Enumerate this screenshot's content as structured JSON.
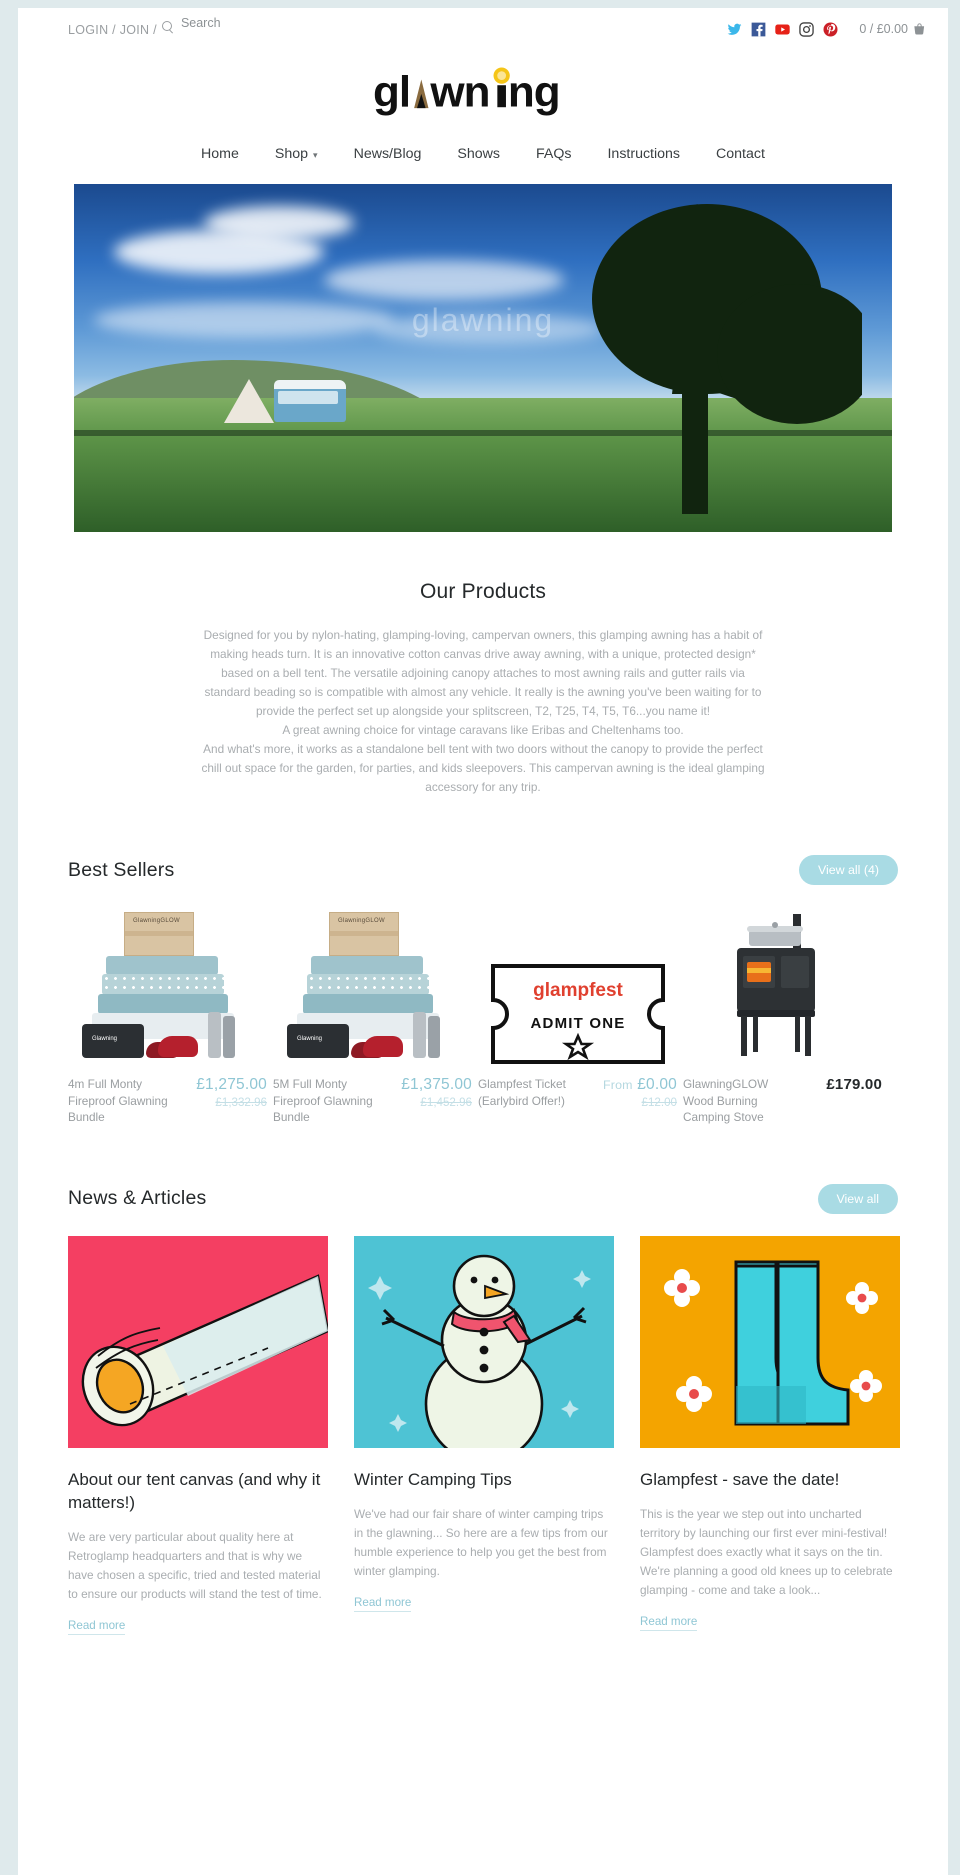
{
  "topbar": {
    "account_label": "LOGIN / JOIN /",
    "search_placeholder": "Search",
    "search_value": "",
    "social": [
      {
        "name": "twitter",
        "color": "#3bb7ea"
      },
      {
        "name": "facebook",
        "color": "#3b5998"
      },
      {
        "name": "youtube",
        "color": "#e62117"
      },
      {
        "name": "instagram",
        "color": "#3f3f3f"
      },
      {
        "name": "pinterest",
        "color": "#cb2027"
      }
    ],
    "cart_label": "0 / £0.00"
  },
  "brand": {
    "name": "glawning",
    "logo_text_color": "#111111",
    "logo_accent_color": "#8a6b3f",
    "logo_sun_color": "#f5c518"
  },
  "nav": {
    "items": [
      {
        "label": "Home",
        "has_dropdown": false
      },
      {
        "label": "Shop",
        "has_dropdown": true
      },
      {
        "label": "News/Blog",
        "has_dropdown": false
      },
      {
        "label": "Shows",
        "has_dropdown": false
      },
      {
        "label": "FAQs",
        "has_dropdown": false
      },
      {
        "label": "Instructions",
        "has_dropdown": false
      },
      {
        "label": "Contact",
        "has_dropdown": false
      }
    ]
  },
  "hero": {
    "watermark": "glawning",
    "alt": "campervan with glawning awning and bell tent in a field at dusk"
  },
  "products_section": {
    "title": "Our Products",
    "paragraphs": [
      "Designed for you by nylon-hating, glamping-loving, campervan owners, this glamping awning has a habit of making heads turn. It is an innovative cotton canvas drive away awning, with a unique, protected design* based on a bell tent. The versatile adjoining canopy attaches to most awning rails and gutter rails via standard beading so is compatible with almost any vehicle. It really is the awning you've been waiting for to provide the perfect set up alongside your splitscreen, T2, T25, T4, T5, T6...you name it!",
      "A great awning choice for vintage caravans like Eribas and Cheltenhams too.",
      "And what's more, it works as a standalone bell tent with two doors without the canopy to provide the perfect chill out space for the garden, for parties, and kids sleepovers. This campervan awning is the ideal glamping accessory for any trip."
    ]
  },
  "best_sellers": {
    "title": "Best Sellers",
    "view_all_label": "View all (4)",
    "items": [
      {
        "name": "4m Full Monty Fireproof Glawning Bundle",
        "price": "£1,275.00",
        "price_prefix": "",
        "price_old": "£1,332.96",
        "image": "bundle-image",
        "box_label": "GlawningGLOW",
        "bag_label": "Glawning"
      },
      {
        "name": "5M Full Monty Fireproof Glawning Bundle",
        "price": "£1,375.00",
        "price_prefix": "",
        "price_old": "£1,452.96",
        "image": "bundle-image",
        "box_label": "GlawningGLOW",
        "bag_label": "Glawning"
      },
      {
        "name": "Glampfest Ticket (Earlybird Offer!)",
        "price": "£0.00",
        "price_prefix": "From",
        "price_old": "£12.00",
        "image": "ticket-image",
        "ticket_word": "glampfest",
        "ticket_admit": "ADMIT ONE"
      },
      {
        "name": "GlawningGLOW Wood Burning Camping Stove",
        "price": "£179.00",
        "price_prefix": "",
        "price_old": "",
        "image": "stove-image",
        "price_style": "dark"
      }
    ]
  },
  "news": {
    "title": "News & Articles",
    "view_all_label": "View all",
    "read_more_label": "Read more",
    "articles": [
      {
        "title": "About our tent canvas (and why it matters!)",
        "excerpt": "We are very particular about quality here at Retroglamp headquarters and that is why we have chosen a specific, tried and tested material to ensure our products will stand the test of time.",
        "image": "canvas-roll-illustration",
        "image_bg": "#f43f62"
      },
      {
        "title": "Winter Camping Tips",
        "excerpt": "We've had our fair share of winter camping trips in the glawning... So here are a few tips from our humble experience to help you get the best from winter glamping.",
        "image": "snowman-illustration",
        "image_bg": "#4ec3d4"
      },
      {
        "title": "Glampfest - save the date!",
        "excerpt": "This is the year we step out into uncharted territory by launching our first ever mini-festival! Glampfest does exactly what it says on the tin. We're planning a good old knees up to celebrate glamping - come and take a look...",
        "image": "wellies-illustration",
        "image_bg": "#f4a400"
      }
    ]
  },
  "theme": {
    "page_bg": "#dfeaec",
    "accent": "#a9dbe4",
    "price_color": "#8fc6d4",
    "muted_text": "#a9adb0"
  }
}
